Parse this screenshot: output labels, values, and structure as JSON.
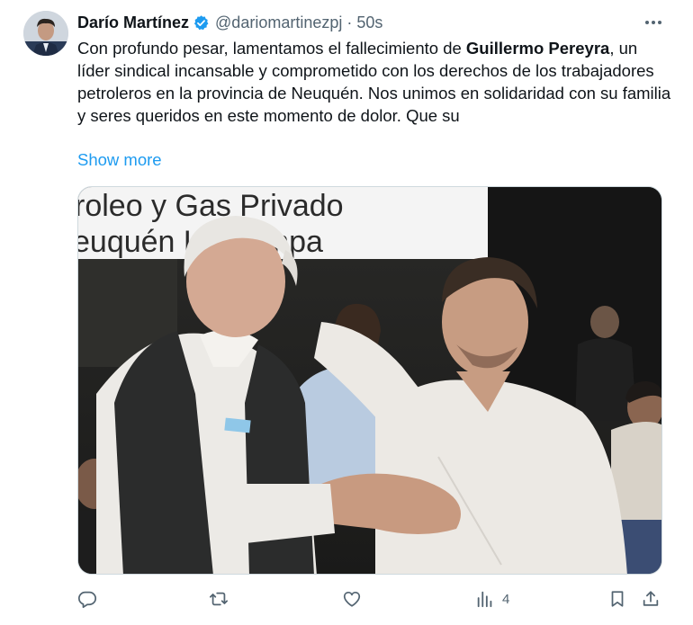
{
  "author": {
    "display_name": "Darío Martínez",
    "handle": "@dariomartinezpj",
    "separator": "·",
    "timestamp": "50s",
    "verified": true
  },
  "tweet": {
    "text_before": "Con profundo pesar, lamentamos el fallecimiento de ",
    "text_bold": "Guillermo Pereyra",
    "text_after": ", un líder sindical incansable y comprometido con los derechos de los trabajadores petroleros en la provincia de Neuquén. Nos unimos en solidaridad con su familia y seres queridos en este momento de dolor. Que su",
    "show_more": "Show more"
  },
  "media": {
    "banner_line1": "roleo y Gas Privado",
    "banner_line2": "euquén La Pampa"
  },
  "actions": {
    "views_count": "4"
  },
  "colors": {
    "accent": "#1d9bf0",
    "muted": "#536471",
    "text": "#0f1419",
    "verified": "#1d9bf0"
  },
  "icons": [
    "verified-badge-icon",
    "more-icon",
    "reply-icon",
    "retweet-icon",
    "like-icon",
    "views-icon",
    "bookmark-icon",
    "share-icon"
  ]
}
